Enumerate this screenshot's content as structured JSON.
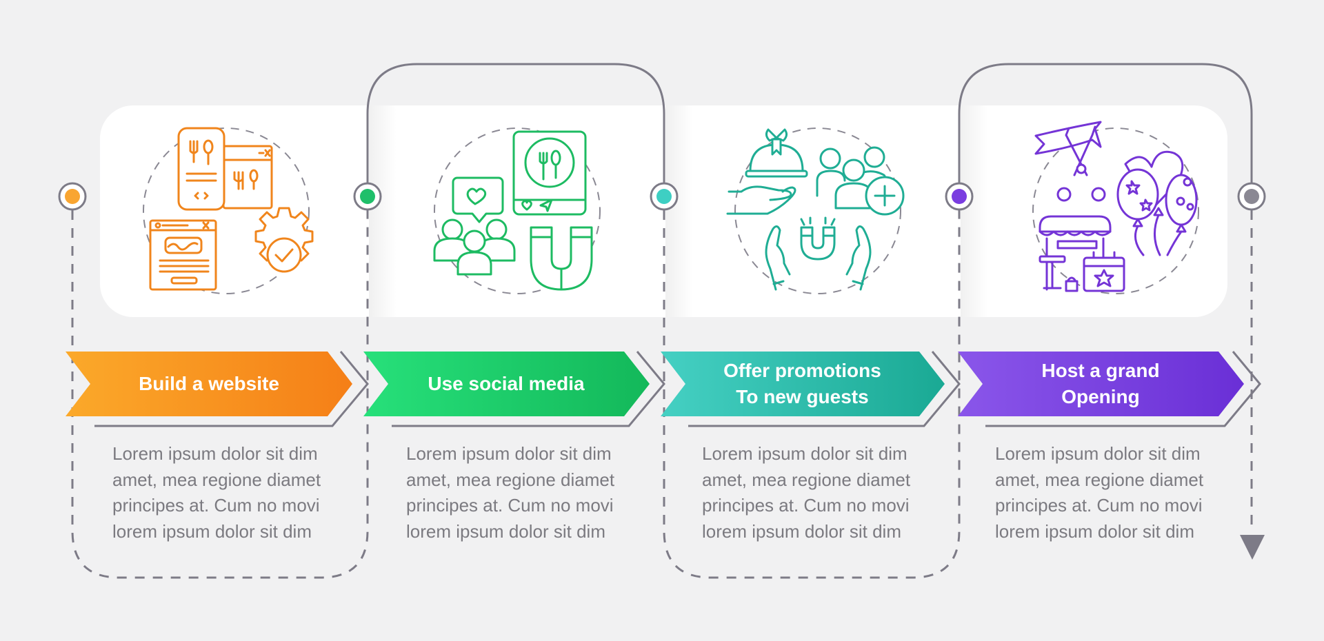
{
  "steps": [
    {
      "title": "Build a website",
      "description_lines": [
        "Lorem ipsum dolor sit dim",
        "amet, mea regione diamet",
        "principes at. Cum no movi",
        "lorem ipsum dolor sit dim"
      ],
      "icon": "restaurant-website-icon",
      "color_start": "#fba92a",
      "color_end": "#f57f17",
      "dot_color": "#f9a531"
    },
    {
      "title": "Use social media",
      "description_lines": [
        "Lorem ipsum dolor sit dim",
        "amet, mea regione diamet",
        "principes at. Cum no movi",
        "lorem ipsum dolor sit dim"
      ],
      "icon": "social-media-marketing-icon",
      "color_start": "#27e07a",
      "color_end": "#13b85a",
      "dot_color": "#1fbf6a"
    },
    {
      "title": "Offer promotions\nTo new guests",
      "description_lines": [
        "Lorem ipsum dolor sit dim",
        "amet, mea regione diamet",
        "principes at. Cum no movi",
        "lorem ipsum dolor sit dim"
      ],
      "icon": "promotion-offer-icon",
      "color_start": "#45d0c3",
      "color_end": "#1aa994",
      "dot_color": "#3ecfc3"
    },
    {
      "title": "Host a grand\nOpening",
      "description_lines": [
        "Lorem ipsum dolor sit dim",
        "amet, mea regione diamet",
        "principes at. Cum no movi",
        "lorem ipsum dolor sit dim"
      ],
      "icon": "grand-opening-icon",
      "color_start": "#8a56ea",
      "color_end": "#6a2fd6",
      "dot_color": "#7a3de0"
    }
  ],
  "end_dot_color": "#8a8893",
  "line_color": "#7d7b87",
  "icon_colors": [
    "#f0851c",
    "#1dbb62",
    "#1fad94",
    "#7434d6"
  ]
}
